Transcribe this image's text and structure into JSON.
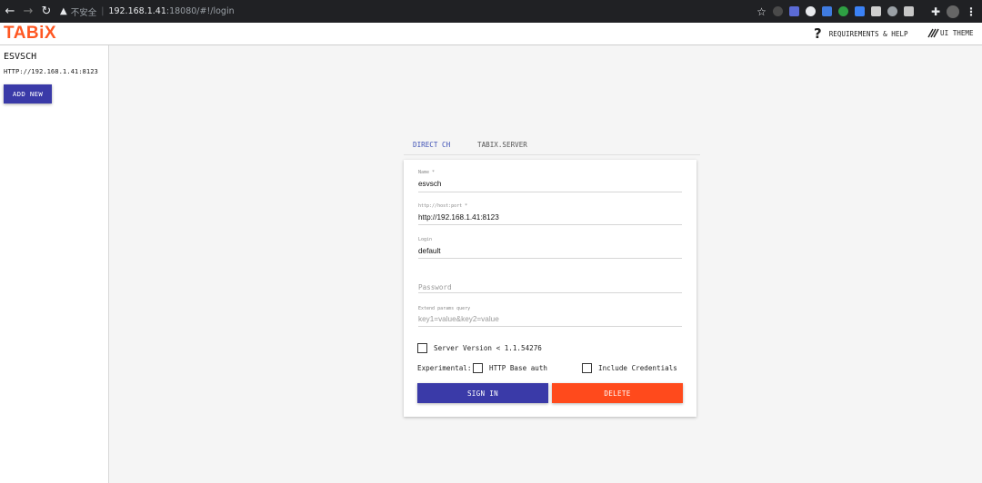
{
  "browser": {
    "insecure_label": "不安全",
    "url_host": "192.168.1.41",
    "url_path": ":18080/#!/login",
    "extension_colors": [
      "#4a4a4a",
      "#5b6bd6",
      "#e8eaed",
      "#3f7be0",
      "#2ea043",
      "#3b82f6",
      "#cfcfcf",
      "#9aa0a6",
      "#c7c7c7"
    ]
  },
  "header": {
    "logo": "TABiX",
    "requirements_label": "REQUIREMENTS & HELP",
    "theme_label": "UI THEME"
  },
  "sidebar": {
    "connection_name": "ESVSCH",
    "connection_url": "HTTP://192.168.1.41:8123",
    "add_new_label": "ADD NEW"
  },
  "tabs": [
    "DIRECT CH",
    "TABIX.SERVER"
  ],
  "form": {
    "name_label": "Name *",
    "name_value": "esvsch",
    "host_label": "http://host:port *",
    "host_value": "http://192.168.1.41:8123",
    "login_label": "Login",
    "login_value": "default",
    "password_placeholder": "Password",
    "extend_label": "Extend params query",
    "extend_placeholder": "key1=value&key2=value",
    "server_version_label": "Server Version < 1.1.54276",
    "experimental_label": "Experimental:",
    "http_base_auth_label": "HTTP Base auth",
    "include_credentials_label": "Include Credentials",
    "sign_in_label": "SIGN IN",
    "delete_label": "DELETE"
  },
  "colors": {
    "accent": "#3a3aa8",
    "danger": "#ff4a1c",
    "logo": "#ff5722"
  }
}
